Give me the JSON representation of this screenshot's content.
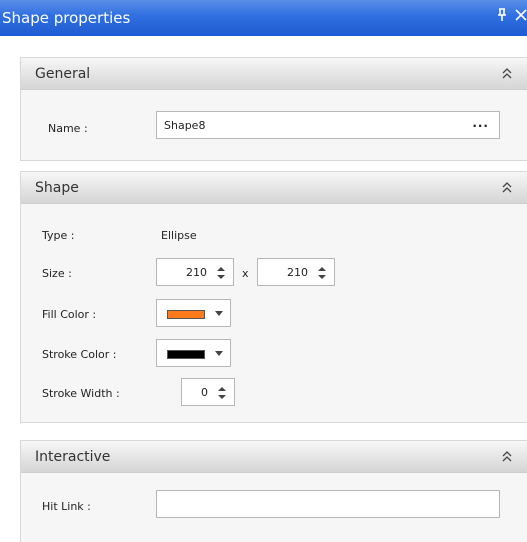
{
  "window": {
    "title": "Shape properties",
    "pin_glyph": "ᵖ",
    "close_glyph": "×"
  },
  "general": {
    "title": "General",
    "name_label": "Name :",
    "name_value": "Shape8",
    "browse_label": "..."
  },
  "shape": {
    "title": "Shape",
    "type_label": "Type :",
    "type_value": "Ellipse",
    "size_label": "Size :",
    "width": "210",
    "times": "x",
    "height": "210",
    "fill_label": "Fill Color :",
    "fill_color": "#ff7a1a",
    "stroke_label": "Stroke Color :",
    "stroke_color": "#000000",
    "stroke_width_label": "Stroke Width :",
    "stroke_width": "0"
  },
  "interactive": {
    "title": "Interactive",
    "hitlink_label": "Hit Link :",
    "hitlink_value": ""
  },
  "icons": {
    "collapse": "chevron-double-up-icon",
    "spin": "spinner-arrows-icon",
    "dropdown": "dropdown-arrow-icon"
  }
}
